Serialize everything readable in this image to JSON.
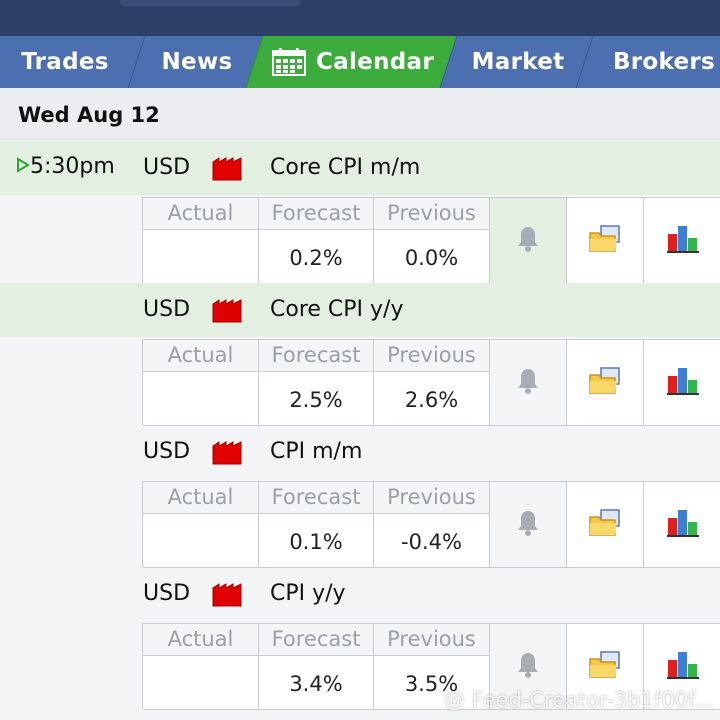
{
  "tabs": [
    {
      "label": "Trades"
    },
    {
      "label": "News"
    },
    {
      "label": "Calendar",
      "active": true,
      "icon": "calendar-icon"
    },
    {
      "label": "Market"
    },
    {
      "label": "Brokers"
    }
  ],
  "date": "Wed Aug 12",
  "columns": {
    "actual": "Actual",
    "forecast": "Forecast",
    "previous": "Previous"
  },
  "events": [
    {
      "time": "5:30pm",
      "currency": "USD",
      "name": "Core CPI m/m",
      "actual": "",
      "forecast": "0.2%",
      "previous": "0.0%",
      "highlight": true,
      "impact": "high"
    },
    {
      "time": "",
      "currency": "USD",
      "name": "Core CPI y/y",
      "actual": "",
      "forecast": "2.5%",
      "previous": "2.6%",
      "highlight": true,
      "impact": "high"
    },
    {
      "time": "",
      "currency": "USD",
      "name": "CPI m/m",
      "actual": "",
      "forecast": "0.1%",
      "previous": "-0.4%",
      "highlight": false,
      "impact": "high"
    },
    {
      "time": "",
      "currency": "USD",
      "name": "CPI y/y",
      "actual": "",
      "forecast": "3.4%",
      "previous": "3.5%",
      "highlight": false,
      "impact": "high"
    }
  ],
  "watermark": "@ Feed-Creator-3b1f00f...",
  "colors": {
    "tab": "#4c6fb0",
    "tab_active": "#3bab3b",
    "header": "#2c3f66",
    "highlight_row": "#e3efe1",
    "impact_high": "#e00000"
  }
}
